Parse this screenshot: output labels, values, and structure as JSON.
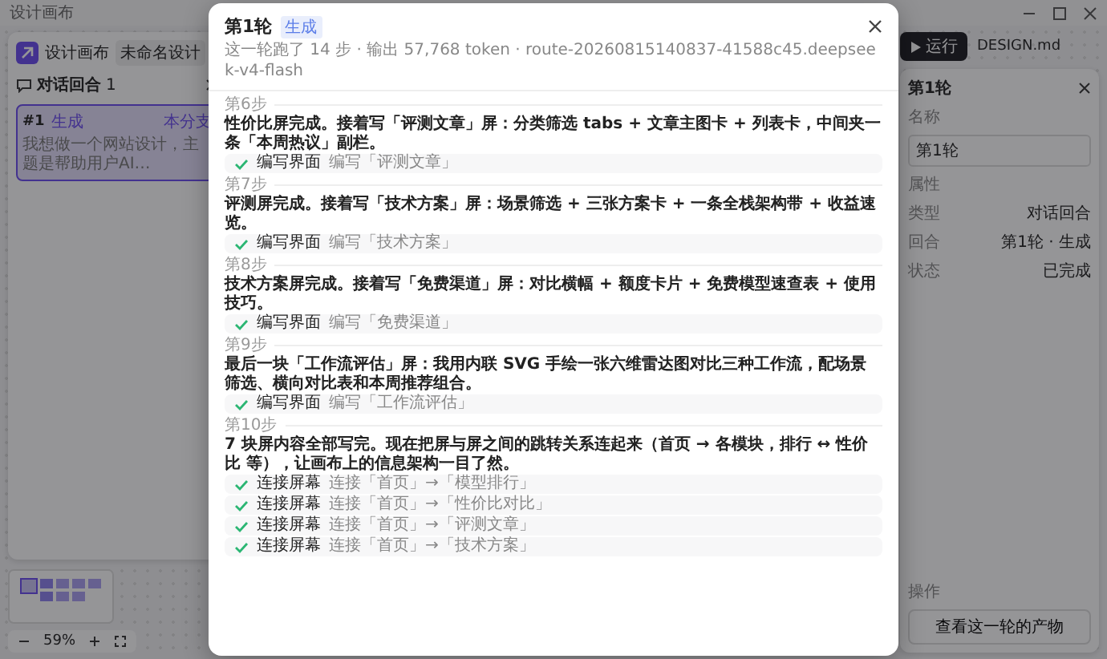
{
  "window": {
    "title": "设计画布"
  },
  "left_panel": {
    "app_name": "设计画布",
    "tab": "未命名设计",
    "section_title": "对话回合",
    "count": "1",
    "turns": [
      {
        "index": "#1",
        "tag": "生成",
        "branch": "本分支",
        "text": "我想做一个网站设计，主题是帮助用户AI…",
        "selected": true
      }
    ]
  },
  "zoom": {
    "value": "59%"
  },
  "toolbar": {
    "run": "运行",
    "file": "DESIGN.md"
  },
  "inspector": {
    "title": "第1轮",
    "name_label": "名称",
    "name_value": "第1轮",
    "props_title": "属性",
    "props": [
      {
        "label": "类型",
        "value": "对话回合"
      },
      {
        "label": "回合",
        "value": "第1轮 · 生成"
      },
      {
        "label": "状态",
        "value": "已完成"
      }
    ],
    "actions_title": "操作",
    "action": "查看这一轮的产物"
  },
  "dialog": {
    "title": "第1轮",
    "badge": "生成",
    "summary": "这一轮跑了 14 步 · 输出 57,768 token · route-20260815140837-41588c45.deepseek-v4-flash",
    "steps": [
      {
        "label": "第6步",
        "text": "性价比屏完成。接着写「评测文章」屏：分类筛选 tabs + 文章主图卡 + 列表卡，中间夹一条「本周热议」副栏。",
        "actions": [
          {
            "title": "编写界面",
            "detail": "编写「评测文章」",
            "done": true
          }
        ]
      },
      {
        "label": "第7步",
        "text": "评测屏完成。接着写「技术方案」屏：场景筛选 + 三张方案卡 + 一条全栈架构带 + 收益速览。",
        "actions": [
          {
            "title": "编写界面",
            "detail": "编写「技术方案」",
            "done": true
          }
        ]
      },
      {
        "label": "第8步",
        "text": "技术方案屏完成。接着写「免费渠道」屏：对比横幅 + 额度卡片 + 免费模型速查表 + 使用技巧。",
        "actions": [
          {
            "title": "编写界面",
            "detail": "编写「免费渠道」",
            "done": true
          }
        ]
      },
      {
        "label": "第9步",
        "text": "最后一块「工作流评估」屏：我用内联 SVG 手绘一张六维雷达图对比三种工作流，配场景筛选、横向对比表和本周推荐组合。",
        "actions": [
          {
            "title": "编写界面",
            "detail": "编写「工作流评估」",
            "done": true
          }
        ]
      },
      {
        "label": "第10步",
        "text": "7 块屏内容全部写完。现在把屏与屏之间的跳转关系连起来（首页 → 各模块，排行 ↔ 性价比 等），让画布上的信息架构一目了然。",
        "actions": [
          {
            "title": "连接屏幕",
            "detail": "连接「首页」→「模型排行」",
            "done": true
          },
          {
            "title": "连接屏幕",
            "detail": "连接「首页」→「性价比对比」",
            "done": true
          },
          {
            "title": "连接屏幕",
            "detail": "连接「首页」→「评测文章」",
            "done": true
          },
          {
            "title": "连接屏幕",
            "detail": "连接「首页」→「技术方案」",
            "done": true
          }
        ]
      }
    ]
  }
}
